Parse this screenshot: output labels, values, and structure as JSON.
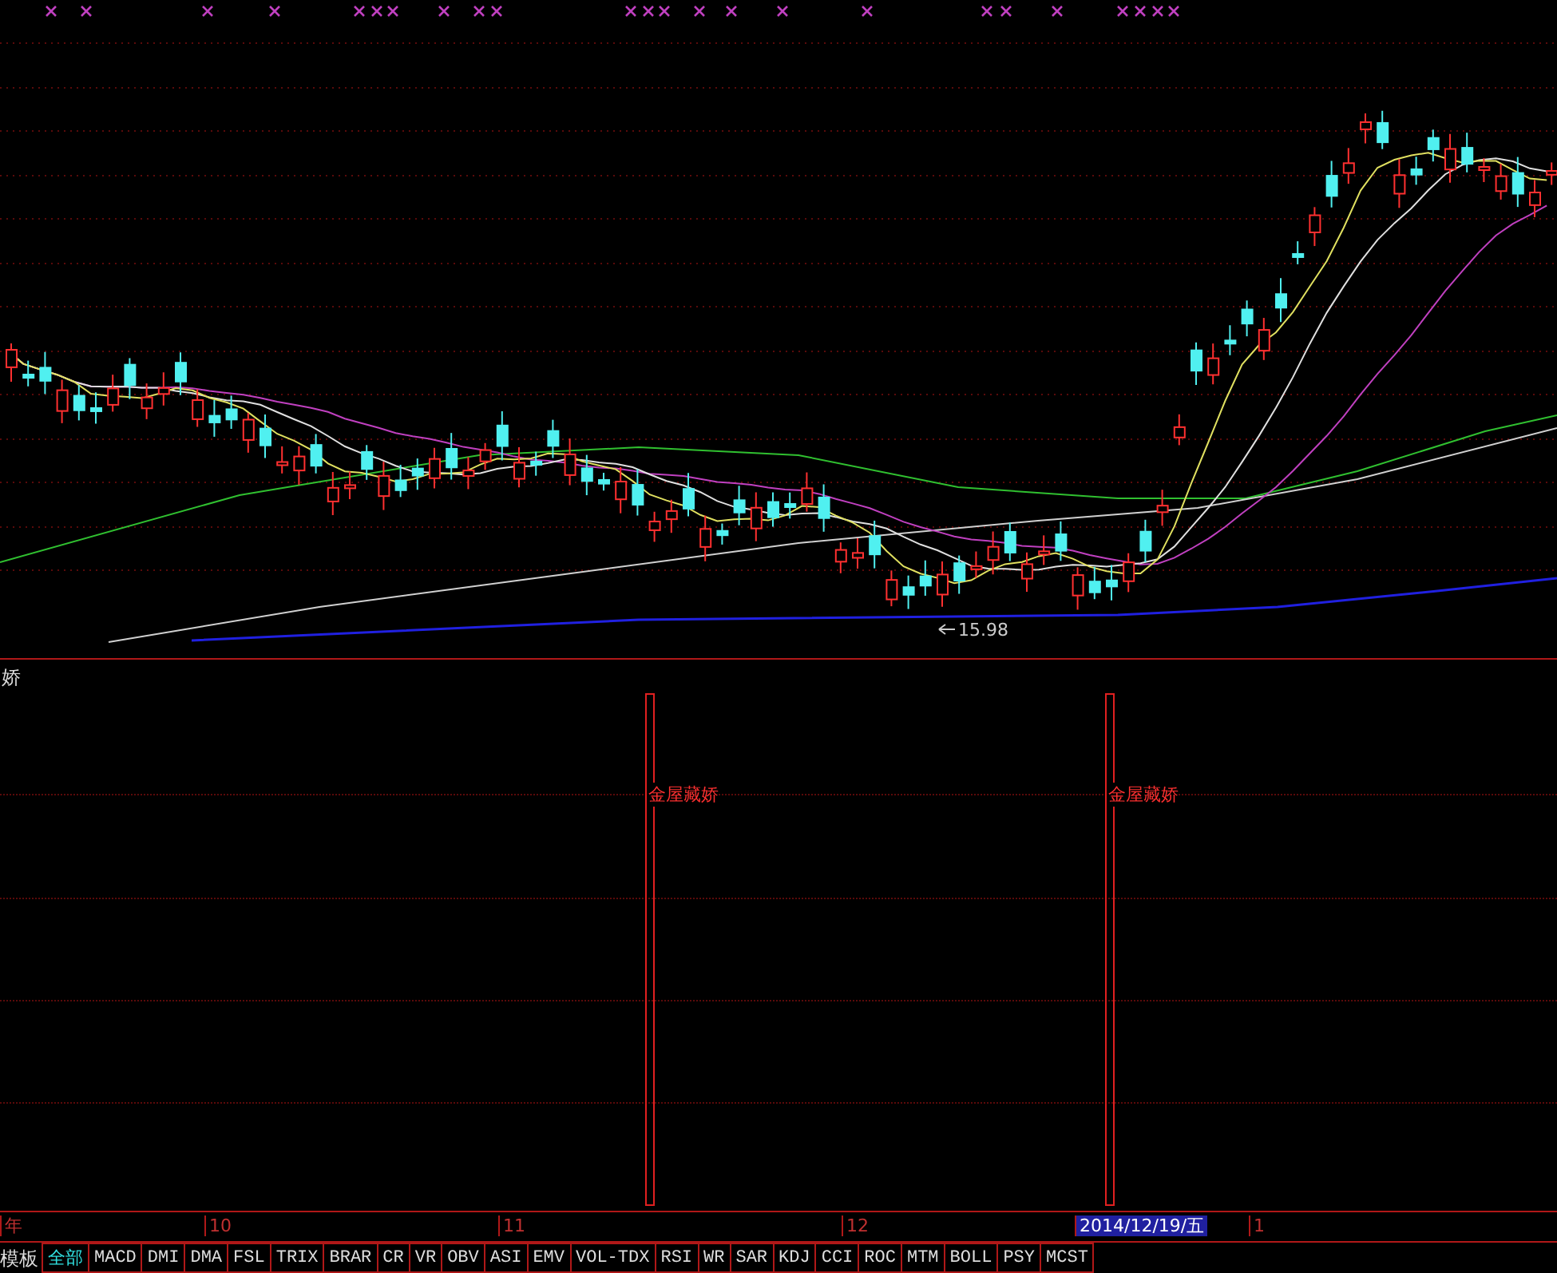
{
  "indicator_panel": {
    "title": "娇",
    "signals": [
      {
        "label": "金屋藏娇"
      },
      {
        "label": "金屋藏娇"
      }
    ]
  },
  "price_chart": {
    "low_price_label": "15.98"
  },
  "date_axis": [
    {
      "label": "年",
      "kind": "month"
    },
    {
      "label": "10",
      "kind": "month"
    },
    {
      "label": "11",
      "kind": "month"
    },
    {
      "label": "12",
      "kind": "month"
    },
    {
      "label": "2014/12/19/五",
      "kind": "cursor"
    },
    {
      "label": "1",
      "kind": "month"
    }
  ],
  "tab_bar": {
    "label": "模板",
    "tabs": [
      {
        "label": "全部",
        "selected": true
      },
      {
        "label": "MACD",
        "selected": false
      },
      {
        "label": "DMI",
        "selected": false
      },
      {
        "label": "DMA",
        "selected": false
      },
      {
        "label": "FSL",
        "selected": false
      },
      {
        "label": "TRIX",
        "selected": false
      },
      {
        "label": "BRAR",
        "selected": false
      },
      {
        "label": "CR",
        "selected": false
      },
      {
        "label": "VR",
        "selected": false
      },
      {
        "label": "OBV",
        "selected": false
      },
      {
        "label": "ASI",
        "selected": false
      },
      {
        "label": "EMV",
        "selected": false
      },
      {
        "label": "VOL-TDX",
        "selected": false
      },
      {
        "label": "RSI",
        "selected": false
      },
      {
        "label": "WR",
        "selected": false
      },
      {
        "label": "SAR",
        "selected": false
      },
      {
        "label": "KDJ",
        "selected": false
      },
      {
        "label": "CCI",
        "selected": false
      },
      {
        "label": "ROC",
        "selected": false
      },
      {
        "label": "MTM",
        "selected": false
      },
      {
        "label": "BOLL",
        "selected": false
      },
      {
        "label": "PSY",
        "selected": false
      },
      {
        "label": "MCST",
        "selected": false
      }
    ]
  }
}
